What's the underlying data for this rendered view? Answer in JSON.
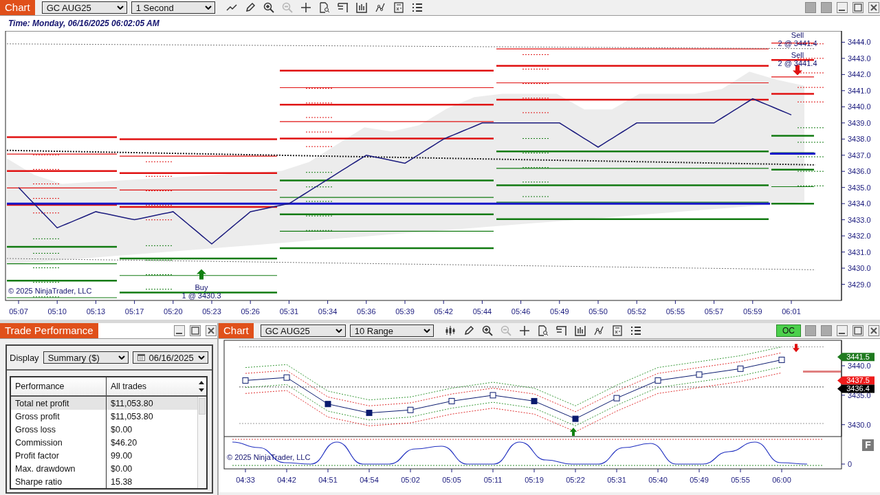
{
  "top_chart": {
    "tab": "Chart",
    "instrument": "GC AUG25",
    "interval": "1 Second",
    "zoom_out_disabled": true,
    "time_label": "Time: Monday, 06/16/2025 06:02:05 AM",
    "copyright": "© 2025 NinjaTrader, LLC",
    "chart_data": {
      "type": "line",
      "categories": [
        "05:07",
        "05:10",
        "05:13",
        "05:17",
        "05:20",
        "05:23",
        "05:26",
        "05:31",
        "05:34",
        "05:36",
        "05:39",
        "05:42",
        "05:44",
        "05:46",
        "05:49",
        "05:50",
        "05:52",
        "05:55",
        "05:57",
        "05:59",
        "06:01"
      ],
      "series": [
        {
          "color": "#1b1b7e",
          "values": [
            3435.0,
            3432.5,
            3433.5,
            3433.0,
            3433.5,
            3431.5,
            3433.5,
            3434.0,
            3435.5,
            3437.0,
            3436.5,
            3438.0,
            3439.0,
            3439.0,
            3439.0,
            3437.5,
            3439.0,
            3439.0,
            3439.0,
            3440.5,
            3439.5
          ]
        }
      ],
      "ylim": [
        3428,
        3444.7
      ],
      "yticks": [
        {
          "value": 3429,
          "label": "3429.0"
        },
        {
          "value": 3430,
          "label": "3430.0"
        },
        {
          "value": 3431,
          "label": "3431.0"
        },
        {
          "value": 3432,
          "label": "3432.0"
        },
        {
          "value": 3433,
          "label": "3433.0"
        },
        {
          "value": 3434,
          "label": "3434.0"
        },
        {
          "value": 3435,
          "label": "3435.0"
        },
        {
          "value": 3436,
          "label": "3436.0"
        },
        {
          "value": 3437,
          "label": "3437.0"
        },
        {
          "value": 3438,
          "label": "3438.0"
        },
        {
          "value": 3439,
          "label": "3439.0"
        },
        {
          "value": 3440,
          "label": "3440.0"
        },
        {
          "value": 3441,
          "label": "3441.0"
        },
        {
          "value": 3442,
          "label": "3442.0"
        },
        {
          "value": 3443,
          "label": "3443.0"
        },
        {
          "value": 3444,
          "label": "3444.0"
        }
      ],
      "annotations": [
        "Sell",
        "2 @ 3441.4",
        "Sell",
        "2 @ 3441.4",
        "Buy",
        "1 @ 3430.3"
      ]
    },
    "trade_markers": [
      {
        "kind": "sell"
      },
      {
        "kind": "buy"
      }
    ]
  },
  "trade_performance": {
    "title": "Trade Performance",
    "display_label": "Display",
    "display_value": "Summary ($)",
    "date": "06/16/2025",
    "columns": [
      "Performance",
      "All trades"
    ],
    "rows": [
      {
        "label": "Total net profit",
        "value": "$11,053.80",
        "selected": true
      },
      {
        "label": "Gross profit",
        "value": "$11,053.80",
        "selected": false
      },
      {
        "label": "Gross loss",
        "value": "$0.00",
        "selected": false
      },
      {
        "label": "Commission",
        "value": "$46.20",
        "selected": false
      },
      {
        "label": "Profit factor",
        "value": "99.00",
        "selected": false
      },
      {
        "label": "Max. drawdown",
        "value": "$0.00",
        "selected": false
      },
      {
        "label": "Sharpe ratio",
        "value": "15.38",
        "selected": false
      }
    ]
  },
  "bottom_chart": {
    "tab": "Chart",
    "instrument": "GC AUG25",
    "interval": "10 Range",
    "zoom_out_disabled": true,
    "status": "OC",
    "copyright": "© 2025 NinjaTrader, LLC",
    "oscillator_tick": "0",
    "panel_button": "F",
    "price_badges": [
      {
        "text": "3441.5",
        "color": "#1f7a1f"
      },
      {
        "text": "3437.5",
        "color": "#ee1c1c"
      },
      {
        "text": "3436.4",
        "color": "#000000"
      }
    ],
    "chart_data": {
      "type": "line",
      "categories": [
        "04:33",
        "04:42",
        "04:51",
        "04:54",
        "05:02",
        "05:05",
        "05:11",
        "05:19",
        "05:22",
        "05:31",
        "05:40",
        "05:49",
        "05:55",
        "06:00"
      ],
      "series": [
        {
          "color": "#0a1a6e",
          "marker": "square",
          "values": [
            3437.5,
            3438.0,
            3433.5,
            3432.0,
            3432.5,
            3434.0,
            3435.0,
            3434.0,
            3431.0,
            3434.5,
            3437.5,
            3438.5,
            3439.5,
            3441.0
          ]
        },
        {
          "color": "#3a9a3a",
          "line_style": "dotted",
          "values": [
            3439.7,
            3440.2,
            3435.7,
            3434.2,
            3434.7,
            3436.2,
            3437.2,
            3436.2,
            3433.2,
            3436.7,
            3439.7,
            3440.7,
            3441.7,
            3443.2
          ]
        },
        {
          "color": "#e03030",
          "line_style": "dotted",
          "values": [
            3438.7,
            3439.2,
            3434.7,
            3433.2,
            3433.7,
            3435.2,
            3436.2,
            3435.2,
            3432.2,
            3435.7,
            3438.7,
            3439.7,
            3440.7,
            3442.2
          ]
        },
        {
          "color": "#3a9a3a",
          "line_style": "dotted",
          "values": [
            3436.3,
            3436.8,
            3432.3,
            3430.8,
            3431.3,
            3432.8,
            3433.8,
            3432.8,
            3429.8,
            3433.3,
            3436.3,
            3437.3,
            3438.3,
            3439.8
          ]
        },
        {
          "color": "#e03030",
          "line_style": "dotted",
          "values": [
            3435.3,
            3435.8,
            3431.3,
            3429.8,
            3430.3,
            3431.8,
            3432.8,
            3431.8,
            3428.8,
            3432.3,
            3435.3,
            3436.3,
            3437.3,
            3438.8
          ]
        }
      ],
      "ylim": [
        3428.1,
        3444.2
      ],
      "yticks": [
        {
          "value": 3430,
          "label": "3430.0"
        },
        {
          "value": 3435,
          "label": "3435.0"
        },
        {
          "value": 3440,
          "label": "3440.0"
        }
      ]
    },
    "trade_markers": [
      {
        "kind": "sell"
      },
      {
        "kind": "buy"
      }
    ]
  }
}
